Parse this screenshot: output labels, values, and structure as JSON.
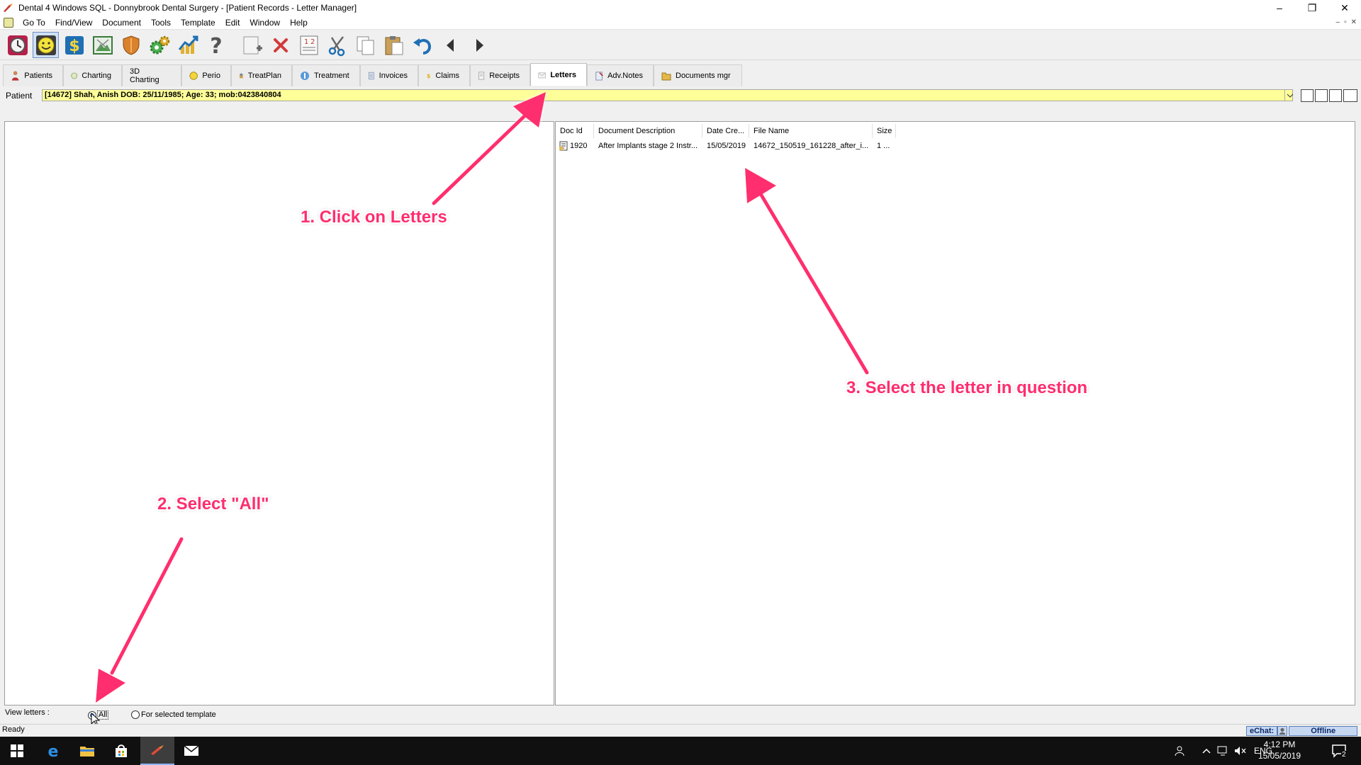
{
  "window": {
    "title": "Dental 4 Windows SQL - Donnybrook Dental Surgery - [Patient Records - Letter Manager]",
    "controls": {
      "minimize": "–",
      "maximize": "❐",
      "close": "✕"
    }
  },
  "menu": {
    "items": [
      "Go To",
      "Find/View",
      "Document",
      "Tools",
      "Template",
      "Edit",
      "Window",
      "Help"
    ],
    "mdi_controls": [
      "–",
      "▫",
      "✕"
    ]
  },
  "toolbar": {
    "buttons": [
      {
        "icon": "clock-icon"
      },
      {
        "icon": "smiley-icon",
        "active": true
      },
      {
        "icon": "dollar-icon"
      },
      {
        "icon": "xray-icon"
      },
      {
        "icon": "shield-icon"
      },
      {
        "icon": "gears-icon"
      },
      {
        "icon": "chart-up-icon"
      },
      {
        "icon": "help-icon"
      },
      {
        "icon": "add-icon"
      },
      {
        "icon": "delete-icon"
      },
      {
        "icon": "numbering-icon"
      },
      {
        "icon": "cut-icon"
      },
      {
        "icon": "copy-icon"
      },
      {
        "icon": "paste-icon"
      },
      {
        "icon": "undo-icon"
      },
      {
        "icon": "back-icon"
      },
      {
        "icon": "forward-icon"
      }
    ]
  },
  "tabs": [
    {
      "label": "Patients",
      "icon": "person-icon"
    },
    {
      "label": "Charting",
      "icon": "tooth-icon"
    },
    {
      "label": "3D Charting",
      "icon": ""
    },
    {
      "label": "Perio",
      "icon": "perio-icon"
    },
    {
      "label": "TreatPlan",
      "icon": "treatplan-icon"
    },
    {
      "label": "Treatment",
      "icon": "treatment-icon"
    },
    {
      "label": "Invoices",
      "icon": "invoice-icon"
    },
    {
      "label": "Claims",
      "icon": "dollar-icon"
    },
    {
      "label": "Receipts",
      "icon": "receipt-icon"
    },
    {
      "label": "Letters",
      "icon": "envelope-icon",
      "active": true
    },
    {
      "label": "Adv.Notes",
      "icon": "notes-icon"
    },
    {
      "label": "Documents mgr",
      "icon": "folder-icon"
    }
  ],
  "patient": {
    "label": "Patient",
    "value": "[14672] Shah, Anish DOB: 25/11/1985; Age: 33; mob:0423840804"
  },
  "letters_grid": {
    "columns": [
      "Doc Id",
      "Document Description",
      "Date Cre...",
      "File Name",
      "Size"
    ],
    "rows": [
      [
        "1920",
        "After Implants stage 2 Instr...",
        "15/05/2019",
        "14672_150519_161228_after_i...",
        "1 ..."
      ]
    ]
  },
  "view_letters": {
    "label": "View letters :",
    "options": [
      {
        "label": "All",
        "checked": true
      },
      {
        "label": "For selected template",
        "checked": false
      }
    ]
  },
  "status": {
    "text": "Ready",
    "echat_label": "eChat:",
    "echat_status": "Offline"
  },
  "taskbar": {
    "language": "ENG",
    "time": "4:12 PM",
    "date": "15/05/2019",
    "notifications": "2"
  },
  "annotations": [
    {
      "text": "1. Click on Letters"
    },
    {
      "text": "2. Select \"All\""
    },
    {
      "text": "3. Select the letter in question"
    }
  ],
  "colors": {
    "annotation": "#ff2d6e",
    "patient_field": "#ffff99",
    "taskbar": "#101010"
  }
}
